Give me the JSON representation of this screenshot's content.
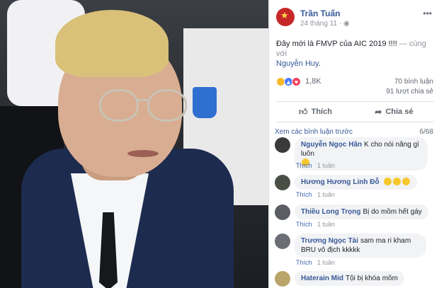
{
  "post": {
    "author": "Trần Tuấn",
    "time": "24 tháng 11 · ",
    "privacy_icon": "globe-icon",
    "text_main": "Đây mới là FMVP của AIC 2019 !!!! ",
    "text_with": "— cùng với",
    "text_tag": "Nguyễn Huy",
    "text_end": ".",
    "reaction_count": "1,8K",
    "comments_count": "70 bình luận",
    "shares_count": "91 lượt chia sẻ"
  },
  "actions": {
    "like_label": "Thích",
    "share_label": "Chia sẻ"
  },
  "comments_header": {
    "view_more": "Xem các bình luận trước",
    "page_count": "6/68"
  },
  "comments": [
    {
      "name": "Nguyễn Ngọc Hân",
      "text": "K cho nói năng gì luôn",
      "like": "Thích",
      "time": "1 tuần",
      "avatar_color": "#3a3a3a"
    },
    {
      "name": "Hương Hương",
      "text": "Linh Đỗ",
      "like": "Thích",
      "time": "1 tuần",
      "avatar_color": "#4a4f45"
    },
    {
      "name": "Thiều Long Trọng",
      "text": "Bị do mồm hết gáy",
      "like": "Thích",
      "time": "1 tuần",
      "avatar_color": "#5a5d63"
    },
    {
      "name": "Trương Ngọc Tài",
      "text": "sam ma ri kham BRU vô địch kkkkk",
      "like": "Thích",
      "time": "1 tuần",
      "avatar_color": "#6b6e74"
    },
    {
      "name": "Haterain Mid",
      "text": "Tội bị khóa mõm",
      "like": "",
      "time": "",
      "avatar_color": "#b9a46a"
    }
  ],
  "colors": {
    "link": "#365899",
    "muted": "#90949c",
    "bubble": "#f2f3f5"
  }
}
